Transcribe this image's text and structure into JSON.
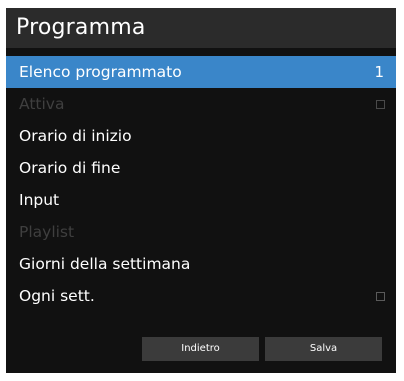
{
  "title": "Programma",
  "items": [
    {
      "label": "Elenco programmato",
      "value": "1",
      "selected": true,
      "enabled": true
    },
    {
      "label": "Attiva",
      "enabled": false,
      "checkbox": true,
      "checked": false
    },
    {
      "label": "Orario di inizio",
      "enabled": true
    },
    {
      "label": "Orario di fine",
      "enabled": true
    },
    {
      "label": "Input",
      "enabled": true
    },
    {
      "label": "Playlist",
      "enabled": false
    },
    {
      "label": "Giorni della settimana",
      "enabled": true
    },
    {
      "label": "Ogni sett.",
      "enabled": true,
      "checkbox": true,
      "checked": false
    }
  ],
  "buttons": {
    "back": "Indietro",
    "save": "Salva"
  },
  "colors": {
    "selected": "#3a86c9",
    "panel": "#111111",
    "title_bar": "#2b2b2b",
    "disabled_text": "#3f3f3f",
    "button": "#3b3b3b"
  }
}
